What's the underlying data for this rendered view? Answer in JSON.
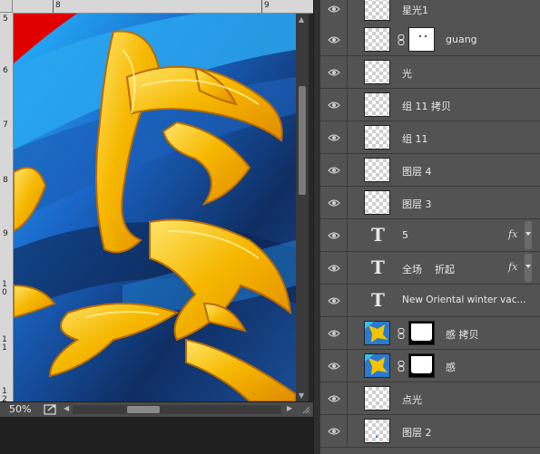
{
  "document": {
    "zoom": "50%",
    "ruler_top_numbers": [
      "8",
      "9"
    ],
    "ruler_left_numbers": [
      "5",
      "6",
      "7",
      "8",
      "9",
      "1 0",
      "1 1",
      "1 2"
    ]
  },
  "layers": [
    {
      "name": "星光1",
      "kind": "pixel",
      "visible": true
    },
    {
      "name": "guang",
      "kind": "pixel-mask",
      "visible": true
    },
    {
      "name": "光",
      "kind": "pixel",
      "visible": true
    },
    {
      "name": "组 11 拷贝",
      "kind": "pixel",
      "visible": true
    },
    {
      "name": "组 11",
      "kind": "pixel",
      "visible": true
    },
    {
      "name": "图层 4",
      "kind": "pixel",
      "visible": true
    },
    {
      "name": "图层 3",
      "kind": "pixel",
      "visible": true
    },
    {
      "name": "5",
      "kind": "text",
      "fx": "fx",
      "visible": true
    },
    {
      "name": "全场    折起",
      "kind": "text",
      "fx": "fx",
      "visible": true
    },
    {
      "name": "New Oriental winter vac...",
      "kind": "text",
      "visible": true
    },
    {
      "name": "感 拷贝",
      "kind": "image-mask",
      "visible": true
    },
    {
      "name": "感",
      "kind": "image-mask",
      "visible": true
    },
    {
      "name": "点光",
      "kind": "pixel",
      "visible": true
    },
    {
      "name": "图层 2",
      "kind": "pixel",
      "visible": true
    }
  ],
  "colors": {
    "panel_bg": "#535353",
    "artwork_gold": "#f5b800",
    "artwork_blue": "#1f7fd6",
    "artwork_red": "#e00000"
  }
}
